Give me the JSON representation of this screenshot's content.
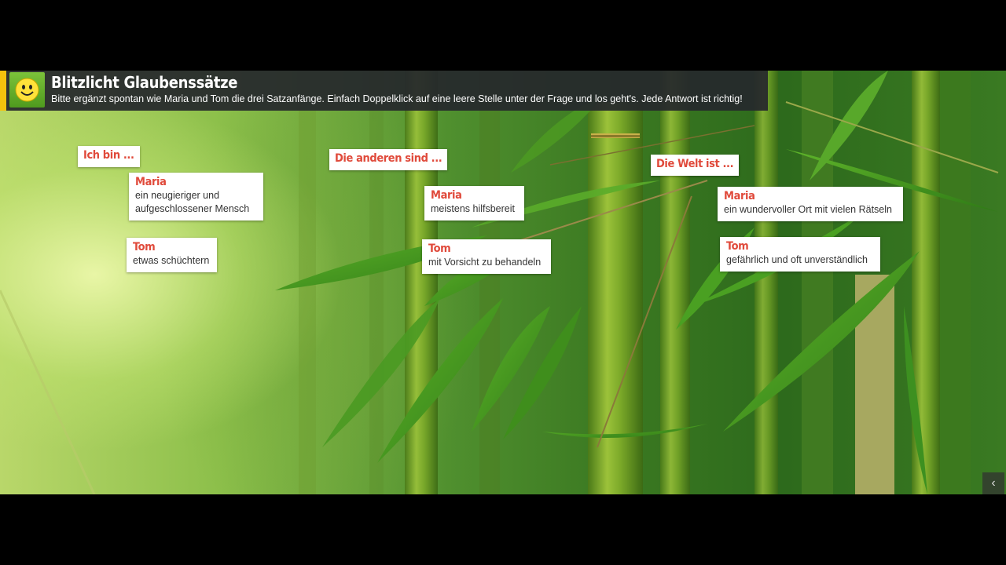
{
  "header": {
    "title": "Blitzlicht Glaubenssätze",
    "subtitle": "Bitte ergänzt spontan wie Maria und Tom die drei Satzanfänge. Einfach Doppelklick auf eine leere Stelle unter der Frage und los geht's. Jede Antwort ist richtig!",
    "icon": "smiley-icon",
    "accent_color": "#f4c20d"
  },
  "questions": [
    {
      "label": "Ich bin ...",
      "answers": [
        {
          "name": "Maria",
          "text": "ein neugieriger und aufgeschlossener Mensch"
        },
        {
          "name": "Tom",
          "text": "etwas schüchtern"
        }
      ]
    },
    {
      "label": "Die anderen sind ...",
      "answers": [
        {
          "name": "Maria",
          "text": "meistens hilfsbereit"
        },
        {
          "name": "Tom",
          "text": "mit Vorsicht zu behandeln"
        }
      ]
    },
    {
      "label": "Die Welt ist ...",
      "answers": [
        {
          "name": "Maria",
          "text": "ein wundervoller Ort mit vielen Rätseln"
        },
        {
          "name": "Tom",
          "text": "gefährlich und oft unverständlich"
        }
      ]
    }
  ],
  "navigation": {
    "prev_icon": "chevron-left-icon",
    "prev_symbol": "‹"
  },
  "colors": {
    "name_red": "#e04a3b",
    "header_bg": "#26282c"
  }
}
